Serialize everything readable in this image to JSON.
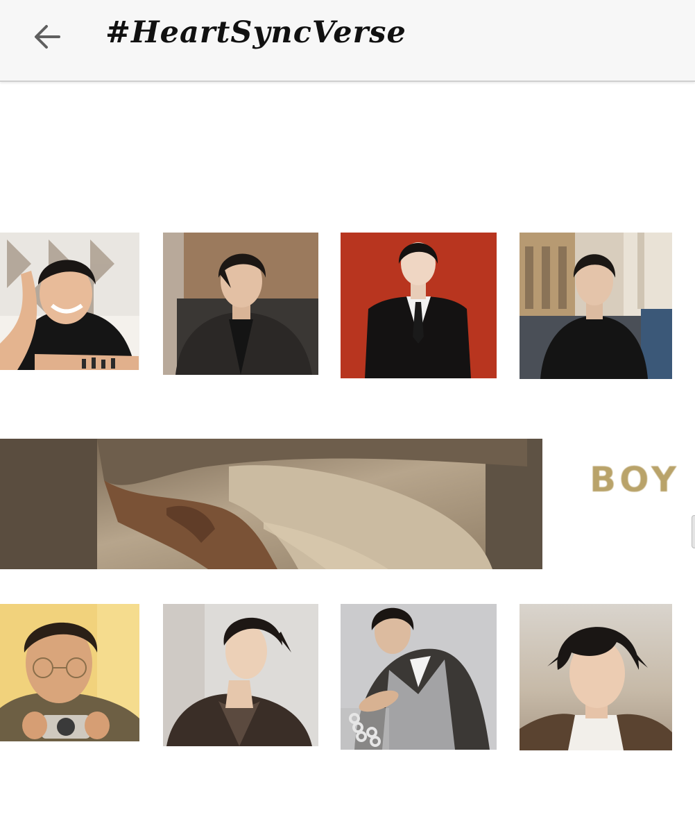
{
  "header": {
    "title": "#HeartSyncVerse",
    "back_icon": "arrow-left-icon"
  },
  "gallery": {
    "row1": [
      {
        "name": "photo-smiling-black-tee",
        "bg": "#e7e3dc"
      },
      {
        "name": "photo-leather-jacket",
        "bg": "#8a6a4f"
      },
      {
        "name": "photo-suit-red-backdrop",
        "bg": "#b83a24"
      },
      {
        "name": "photo-street-black-jacket",
        "bg": "#cfc6b8"
      }
    ],
    "row2": [
      {
        "name": "photo-camera-glasses",
        "bg": "#f0d27a"
      },
      {
        "name": "photo-brown-blazer",
        "bg": "#dcdad7"
      },
      {
        "name": "photo-tweed-sweater",
        "bg": "#c9c9cb"
      },
      {
        "name": "photo-messy-hair-closeup",
        "bg": "#c4beb6"
      }
    ]
  },
  "banner": {
    "text": "BOY",
    "accent": "#b9a36a"
  }
}
